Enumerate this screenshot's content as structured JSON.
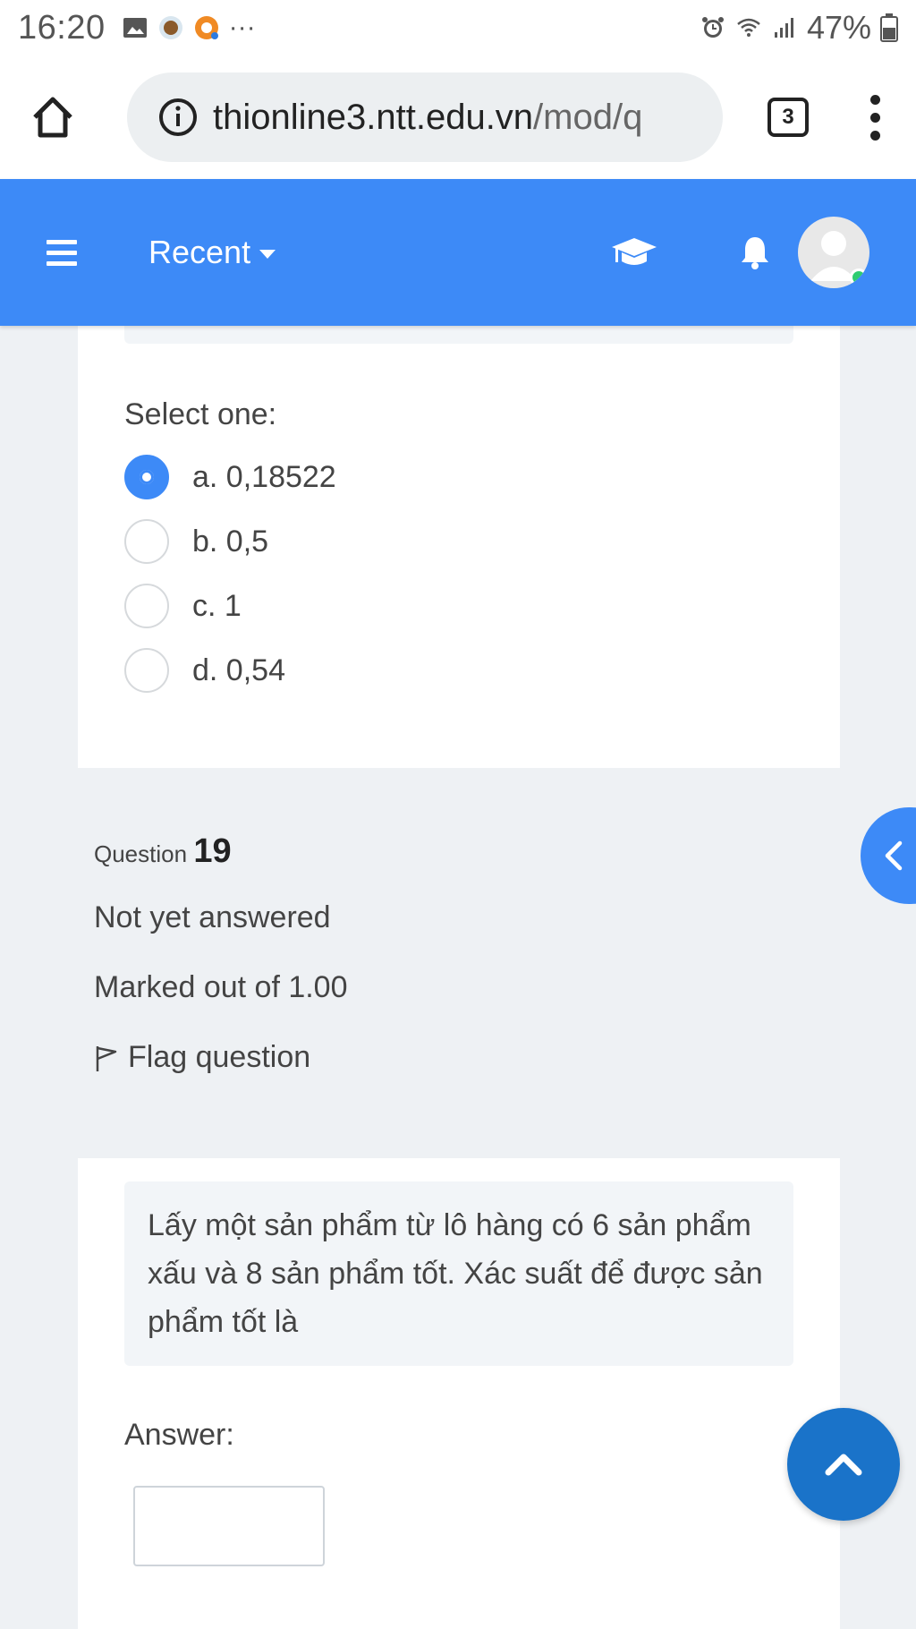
{
  "status_bar": {
    "time": "16:20",
    "more": "···",
    "battery_pct": "47%"
  },
  "browser": {
    "url_host": "thionline3.ntt.edu.vn",
    "url_path": "/mod/q",
    "tab_count": "3"
  },
  "navbar": {
    "recent_label": "Recent",
    "accent_color": "#3d8af7"
  },
  "prev_question": {
    "select_label": "Select one:",
    "options": [
      {
        "label": "a. 0,18522",
        "checked": true
      },
      {
        "label": "b. 0,5",
        "checked": false
      },
      {
        "label": "c. 1",
        "checked": false
      },
      {
        "label": "d. 0,54",
        "checked": false
      }
    ]
  },
  "question": {
    "prefix": "Question",
    "number": "19",
    "status": "Not yet answered",
    "marks": "Marked out of 1.00",
    "flag_label": "Flag question",
    "text": "Lấy một sản phẩm từ lô hàng có 6 sản phẩm xấu và 8 sản phẩm tốt. Xác suất để được sản phẩm tốt là",
    "answer_label": "Answer:",
    "answer_value": ""
  }
}
